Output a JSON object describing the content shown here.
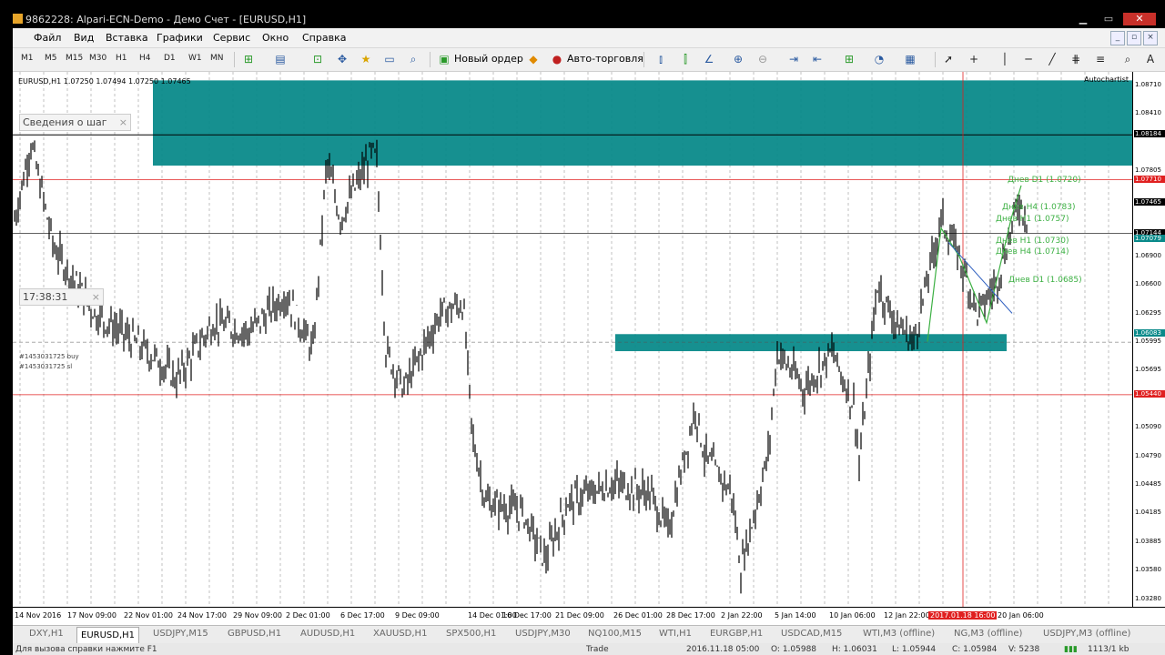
{
  "window": {
    "title": "9862228: Alpari-ECN-Demo - Демо Счет - [EURUSD,H1]"
  },
  "menu": [
    "Файл",
    "Вид",
    "Вставка",
    "Графики",
    "Сервис",
    "Окно",
    "Справка"
  ],
  "timeframes": [
    "M1",
    "M5",
    "M15",
    "M30",
    "H1",
    "H4",
    "D1",
    "W1",
    "MN"
  ],
  "toolbar": {
    "new_order": "Новый ордер",
    "auto_trading": "Авто-торговля"
  },
  "chart": {
    "symbol_line": "EURUSD,H1  1.07250 1.07494 1.07250 1.07465",
    "autochartist": "Autochartist",
    "info_box": "Сведения о шаг",
    "time_box": "17:38:31",
    "order1": "#1453031725 buy",
    "order2": "#1453031725 sl",
    "price_labels": [
      "1.08710",
      "1.08410",
      "1.08184",
      "1.07805",
      "1.07710",
      "1.07465",
      "1.07144",
      "1.07079",
      "1.06900",
      "1.06600",
      "1.06295",
      "1.06083",
      "1.05995",
      "1.05695",
      "1.05440",
      "1.05090",
      "1.04790",
      "1.04485",
      "1.04185",
      "1.03885",
      "1.03580",
      "1.03280"
    ],
    "highlighted_prices": {
      "1.08184": "#000000",
      "1.07710": "#e02020",
      "1.07465": "#000000",
      "1.07144": "#000000",
      "1.07079": "#0a8a8a",
      "1.06083": "#0a8a8a",
      "1.05440": "#e02020"
    },
    "time_labels": [
      "14 Nov 2016",
      "17 Nov 09:00",
      "22 Nov 01:00",
      "24 Nov 17:00",
      "29 Nov 09:00",
      "2 Dec 01:00",
      "6 Dec 17:00",
      "9 Dec 09:00",
      "14 Dec 01:00",
      "16 Dec 17:00",
      "21 Dec 09:00",
      "26 Dec 01:00",
      "28 Dec 17:00",
      "2 Jan 22:00",
      "5 Jan 14:00",
      "10 Jan 06:00",
      "12 Jan 22:00",
      "2017.01.18 16:00",
      "20 Jan 06:00"
    ],
    "highlighted_time": "2017.01.18 16:00",
    "patterns": [
      "Днев D1 (1.0720)",
      "Днев H4 (1.0783)",
      "Днев H1 (1.0757)",
      "Днев H1 (1.0730)",
      "Днев H4 (1.0714)",
      "Днев D1 (1.0685)"
    ],
    "colors": {
      "zone": "#0a8a8a",
      "candle": "#000000",
      "support": "#e02020",
      "bg": "#ffffff"
    }
  },
  "tabs": [
    "DXY,H1",
    "EURUSD,H1",
    "USDJPY,M15",
    "GBPUSD,H1",
    "AUDUSD,H1",
    "XAUUSD,H1",
    "SPX500,H1",
    "USDJPY,M30",
    "NQ100,M15",
    "WTI,H1",
    "EURGBP,H1",
    "USDCAD,M15",
    "WTI,M3 (offline)",
    "NG,M3 (offline)",
    "USDJPY,M3 (offline)"
  ],
  "active_tab": "EURUSD,H1",
  "status": {
    "help": "Для вызова справки нажмите F1",
    "mode": "Trade",
    "time": "2016.11.18 05:00",
    "open": "O: 1.05988",
    "high": "H: 1.06031",
    "low": "L: 1.05944",
    "close": "C: 1.05984",
    "volume": "V: 5238",
    "traffic": "1113/1 kb"
  }
}
